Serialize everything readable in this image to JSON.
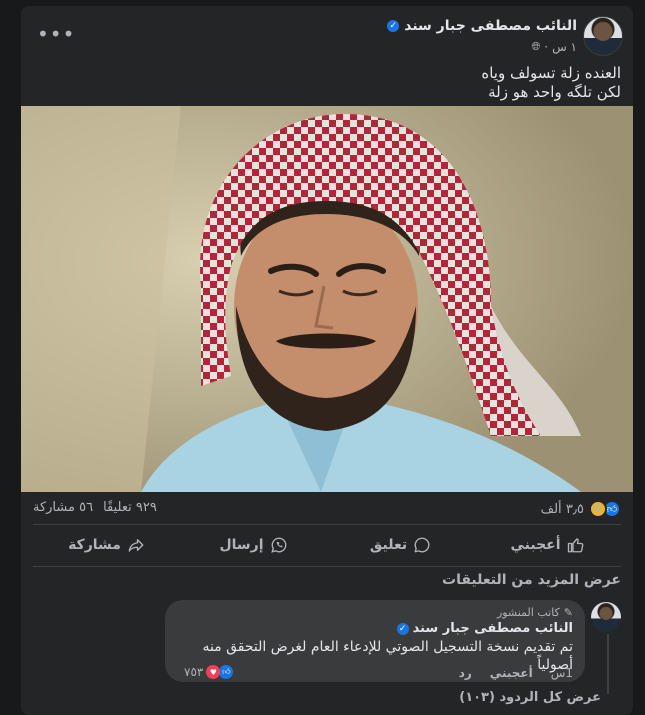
{
  "post": {
    "author": "النائب مصطفى جبار سند",
    "time": "١ س",
    "separator": "·",
    "text_lines": [
      "العنده زلة تسولف وياه",
      "لكن تلگه واحد هو زلة"
    ],
    "more_label": "•••"
  },
  "stats": {
    "reactions_count": "٣٫٥ ألف",
    "comments": "٩٢٩ تعليقًا",
    "shares": "٥٦ مشاركة"
  },
  "actions": {
    "like": "أعجبني",
    "comment": "تعليق",
    "send": "إرسال",
    "share": "مشاركة"
  },
  "comments_section": {
    "more_comments": "عرض المزيد من التعليقات",
    "comment": {
      "badge": "كاتب المنشور",
      "author": "النائب مصطفى جبار سند",
      "text": "تم تقديم نسخة التسجيل الصوتي للإدعاء العام لغرض التحقق منه أصولياً",
      "reaction_count": "٧٥٣",
      "time": "1س",
      "like": "أعجبني",
      "reply": "رد"
    },
    "view_replies": "عرض كل الردود (١٠٣)"
  },
  "colors": {
    "background": "#18191a",
    "card": "#242526",
    "accent": "#1b74e4",
    "text": "#e4e6eb",
    "muted": "#b0b3b8"
  }
}
